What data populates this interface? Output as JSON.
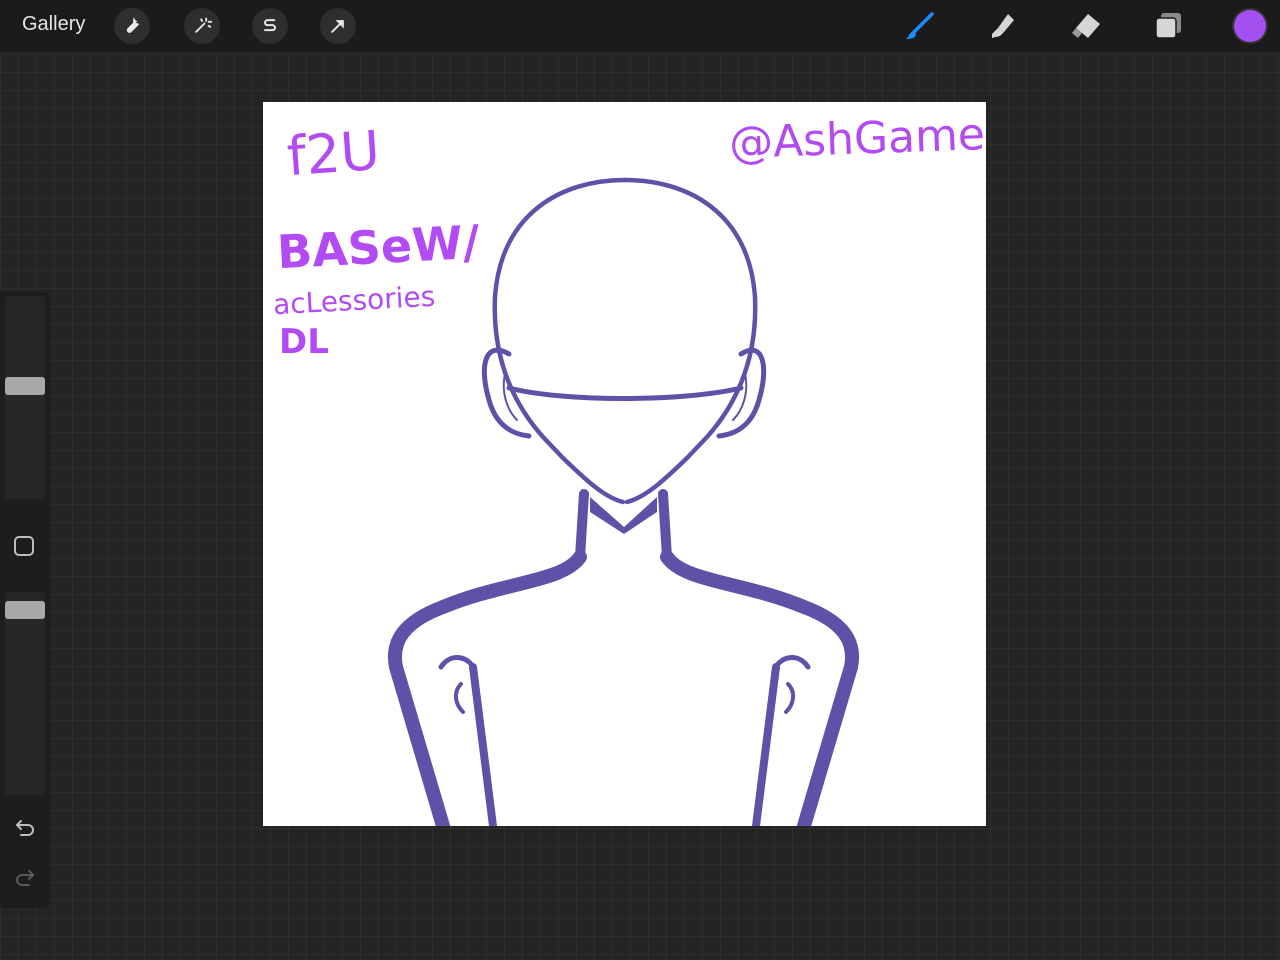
{
  "toolbar": {
    "gallery_label": "Gallery",
    "left_tools": [
      {
        "name": "actions",
        "icon": "wrench-icon"
      },
      {
        "name": "adjustments",
        "icon": "magic-wand-icon"
      },
      {
        "name": "selection",
        "icon": "selection-s-icon"
      },
      {
        "name": "transform",
        "icon": "arrow-cursor-icon"
      }
    ],
    "right_tools": [
      {
        "name": "brush",
        "icon": "brush-icon",
        "active": true,
        "color": "#1a8cff"
      },
      {
        "name": "smudge",
        "icon": "smudge-icon",
        "active": false
      },
      {
        "name": "eraser",
        "icon": "eraser-icon",
        "active": false
      },
      {
        "name": "layers",
        "icon": "layers-icon",
        "active": false
      }
    ],
    "current_color": "#a450f0"
  },
  "sidebar": {
    "brush_size_level": 0.56,
    "opacity_level": 0.95,
    "modify_button_icon": "square-icon",
    "undo_icon": "undo-icon",
    "redo_icon": "redo-icon",
    "redo_enabled": false
  },
  "canvas": {
    "background": "#ffffff",
    "line_color": "#6051a8",
    "text_color": "#b24bf3",
    "texts": {
      "f2u": "f2U",
      "base": "BASeW/",
      "accessories": "acLessories",
      "dl": "DL",
      "handle": "@AshGameZZZ"
    }
  }
}
